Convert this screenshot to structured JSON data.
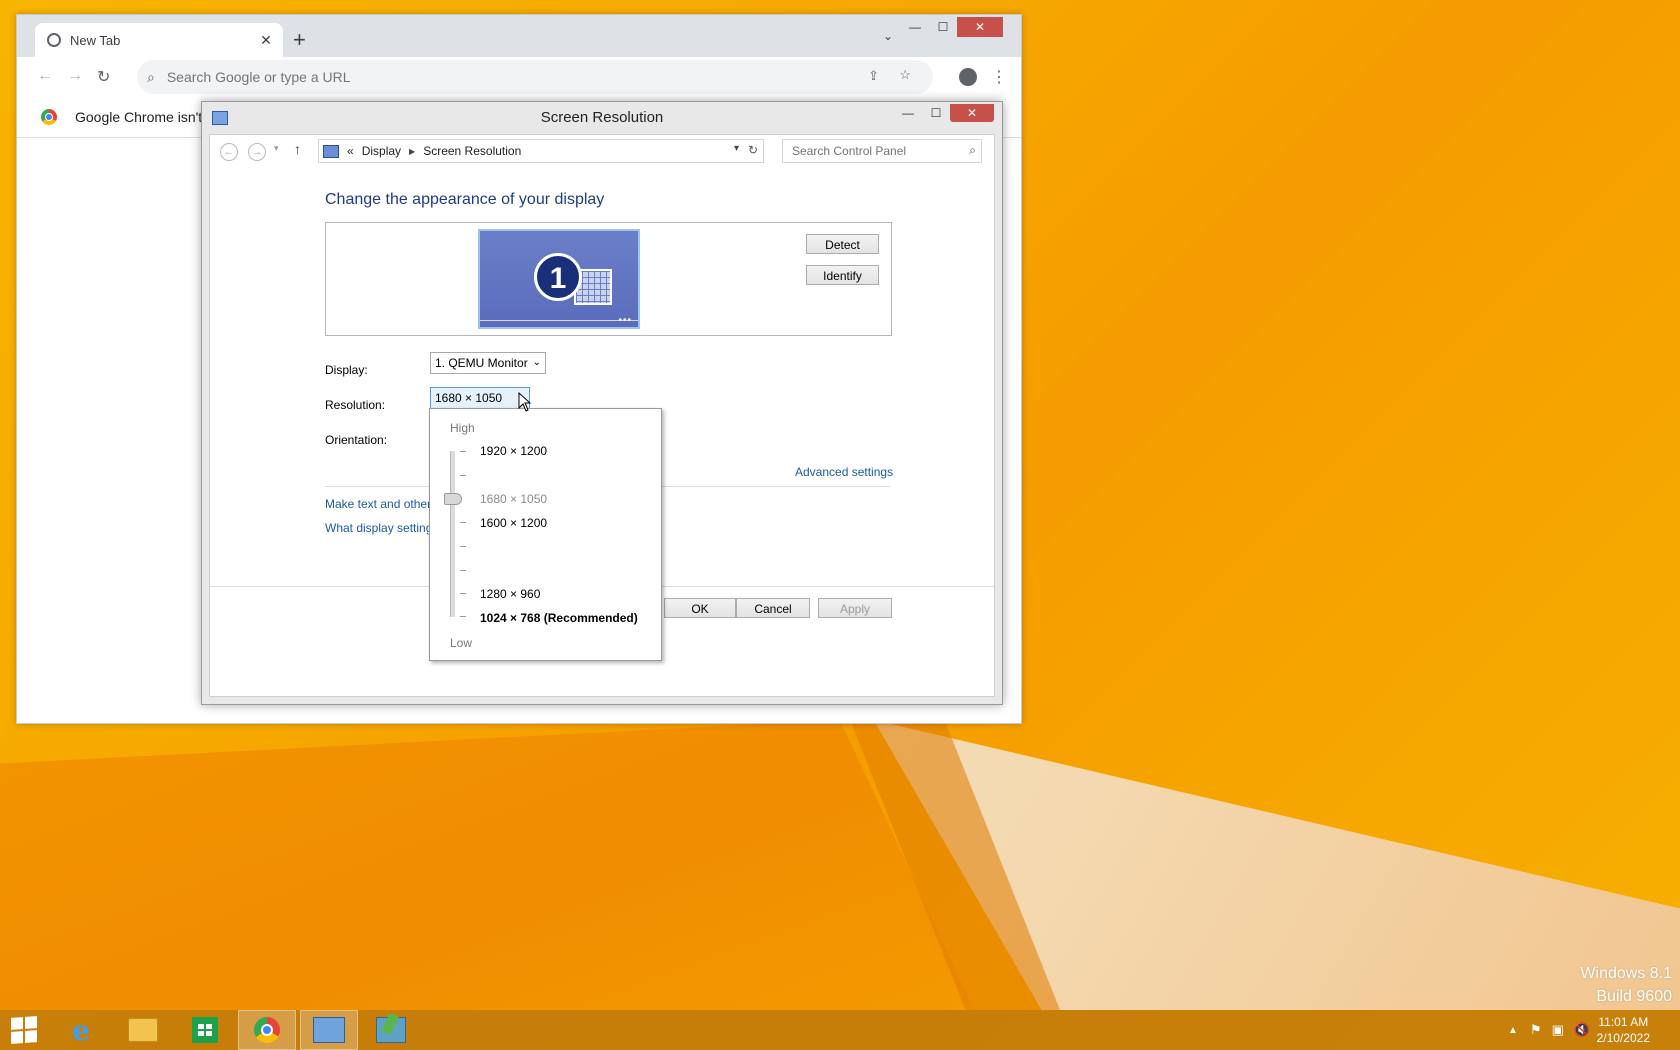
{
  "chrome": {
    "tab_title": "New Tab",
    "tab_close": "✕",
    "new_tab": "+",
    "tab_dropdown": "⌄",
    "omnibox_placeholder": "Search Google or type a URL",
    "infobar_message": "Google Chrome isn't y"
  },
  "dialog": {
    "title": "Screen Resolution",
    "breadcrumb": {
      "prefix": "«",
      "items": [
        "Display",
        "Screen Resolution"
      ]
    },
    "search_placeholder": "Search Control Panel",
    "heading": "Change the appearance of your display",
    "monitor_number": "1",
    "detect_label": "Detect",
    "identify_label": "Identify",
    "display_label": "Display:",
    "display_value": "1. QEMU Monitor",
    "resolution_label": "Resolution:",
    "resolution_value": "1680 × 1050",
    "orientation_label": "Orientation:",
    "advanced_link": "Advanced settings",
    "make_text_link": "Make text and other",
    "what_display_link": "What display setting",
    "ok_label": "OK",
    "cancel_label": "Cancel",
    "apply_label": "Apply"
  },
  "resolution_dropdown": {
    "high_label": "High",
    "low_label": "Low",
    "options": [
      {
        "label": "1920 × 1200",
        "state": "normal"
      },
      {
        "label": "1680 × 1050",
        "state": "current"
      },
      {
        "label": "1600 × 1200",
        "state": "normal"
      },
      {
        "label": "1280 × 960",
        "state": "normal"
      },
      {
        "label": "1024 × 768 (Recommended)",
        "state": "recommended"
      }
    ]
  },
  "desktop": {
    "watermark_line1": "Windows 8.1",
    "watermark_line2": "Build 9600"
  },
  "taskbar": {
    "apps": [
      "start-icon",
      "internet-explorer-icon",
      "file-explorer-icon",
      "store-icon",
      "chrome-icon",
      "control-panel-icon",
      "tool-icon"
    ],
    "time": "11:01 AM",
    "date": "2/10/2022"
  }
}
